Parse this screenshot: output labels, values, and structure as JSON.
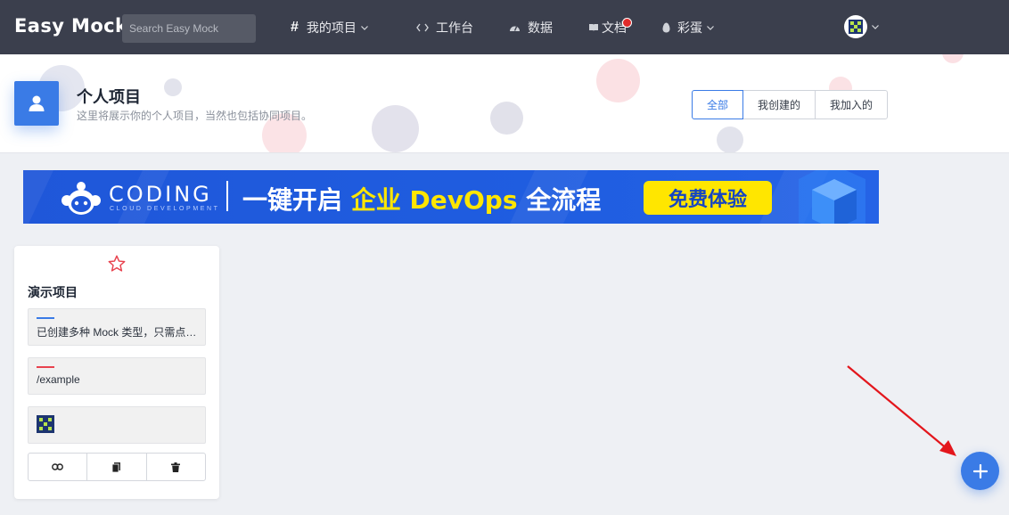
{
  "header": {
    "logo": "Easy Mock",
    "search": {
      "placeholder": "Search Easy Mock",
      "value": ""
    },
    "nav": {
      "projects": "我的项目",
      "workbench": "工作台",
      "data": "数据",
      "docs": "文档",
      "easter_egg": "彩蛋"
    }
  },
  "page": {
    "title": "个人项目",
    "subtitle": "这里将展示你的个人项目，当然也包括协同项目。",
    "filters": [
      "全部",
      "我创建的",
      "我加入的"
    ],
    "active_filter": "全部"
  },
  "banner": {
    "brand": "CODING",
    "brand_sub": "CLOUD DEVELOPMENT",
    "headline_prefix": "一键开启",
    "headline_highlight": "企业 DevOps",
    "headline_suffix": "全流程",
    "cta": "免费体验"
  },
  "project_card": {
    "name": "演示项目",
    "description": "已创建多种 Mock 类型，只需点击预览便可查看效果",
    "url": "/example",
    "description_accent": "#3a7be6",
    "url_accent": "#e8424e",
    "actions": [
      "link-icon",
      "copy-icon",
      "trash-icon"
    ]
  },
  "colors": {
    "topbar": "#3b3f4d",
    "primary": "#3a7be6",
    "star": "#e8424e",
    "banner_highlight": "#ffe600"
  }
}
